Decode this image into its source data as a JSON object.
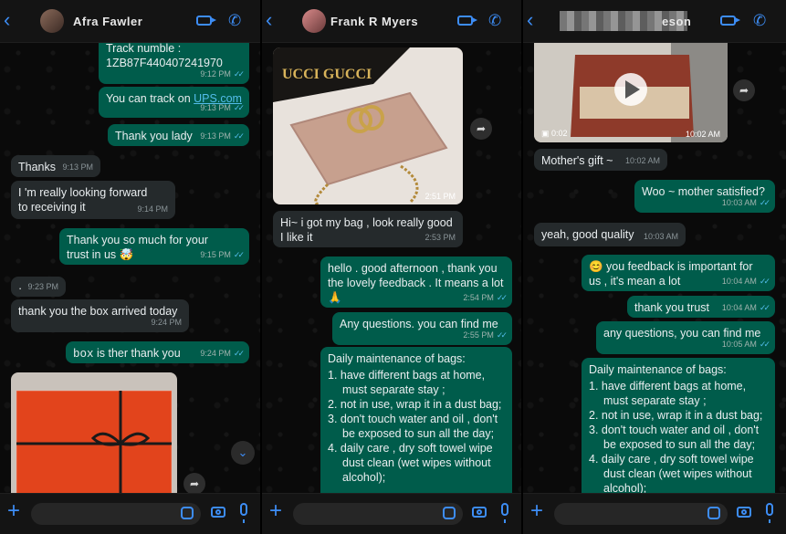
{
  "panel1": {
    "contact": "Afra Fawler",
    "messages": [
      {
        "text": "Track numble :",
        "text2": "1ZB87F440407241970",
        "time": "9:12 PM"
      },
      {
        "text": "You can track on ",
        "link": "UPS.com",
        "time": "9:13 PM"
      },
      {
        "text": "Thank you lady",
        "time": "9:13 PM"
      },
      {
        "text": "Thanks",
        "time": "9:13 PM"
      },
      {
        "text": "I 'm  really looking forward to receiving it",
        "time": "9:14 PM"
      },
      {
        "text": "Thank you so much for your  trust in us 🤯",
        "time": "9:15 PM"
      },
      {
        "text": "·",
        "time": "9:23 PM"
      },
      {
        "text": "thank you the box arrived today",
        "time": "9:24 PM"
      },
      {
        "text": "box",
        "text2": " is ther thank you",
        "time": "9:24 PM"
      }
    ]
  },
  "panel2": {
    "contact": "Frank R Myers",
    "image_text": "UCCI GUCCI",
    "image_time": "2:51 PM",
    "messages": [
      {
        "text": "Hi~ i got my bag , look really good I like it",
        "time": "2:53 PM"
      },
      {
        "text": "hello . good afternoon , thank you the lovely feedback . It means a lot 🙏",
        "time": "2:54 PM"
      },
      {
        "text": "Any questions. you can find me",
        "time": "2:55 PM"
      }
    ],
    "maintenance": {
      "title": "Daily maintenance of bags:",
      "items": [
        "1. have different bags at home, must separate stay ;",
        "2. not in use, wrap it in a dust bag;",
        "3. don't touch water and oil , don't be exposed to sun all the day;",
        "4. daily care ,  dry soft towel wipe dust  clean (wet wipes without alcohol);"
      ]
    }
  },
  "panel3": {
    "contact": "eson",
    "video_duration": "0:02",
    "video_time": "10:02 AM",
    "messages": [
      {
        "text": "Mother's gift ~",
        "time": "10:02 AM"
      },
      {
        "text": "Woo ~ mother satisfied?",
        "time": "10:03 AM"
      },
      {
        "text": "yeah, good quality",
        "time": "10:03 AM"
      },
      {
        "text": "😊 you feedback is important for us , it's mean a lot",
        "time": "10:04 AM"
      },
      {
        "text": "thank you trust",
        "time": "10:04 AM"
      },
      {
        "text": "any questions, you can find me",
        "time": "10:05 AM"
      }
    ],
    "maintenance": {
      "title": "Daily maintenance of bags:",
      "items": [
        "1. have different bags at home, must separate stay ;",
        "2. not in use, wrap it in a dust bag;",
        "3. don't touch water and oil , don't be exposed to sun all the day;",
        "4. daily care ,  dry soft towel wipe dust  clean (wet wipes without alcohol);"
      ]
    }
  }
}
